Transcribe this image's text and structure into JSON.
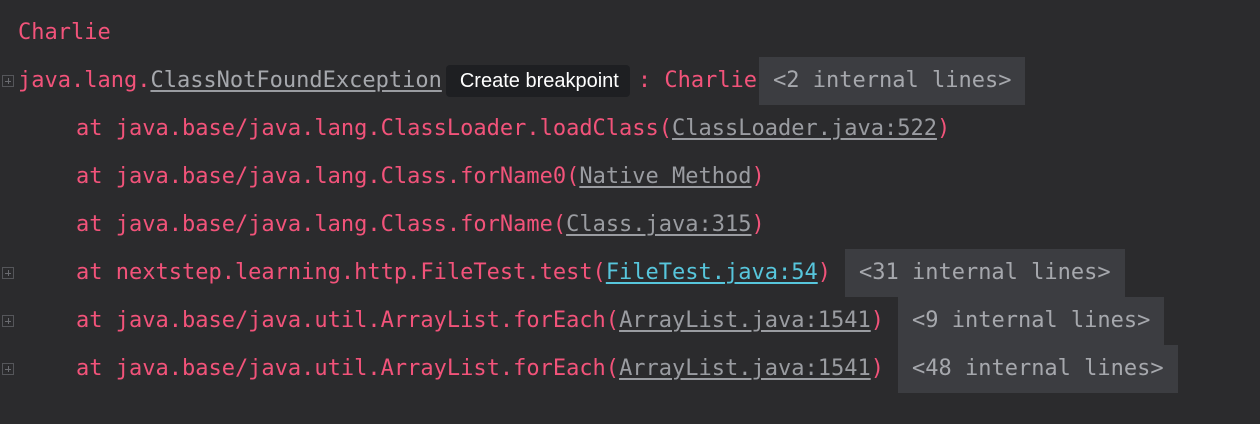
{
  "console": {
    "thread_name": "Charlie",
    "exception": {
      "prefix": "java.lang.",
      "class_name": "ClassNotFoundException",
      "tooltip": "Create breakpoint",
      "suffix": ": Charlie",
      "fold": "<2 internal lines>"
    },
    "frames": [
      {
        "text": "at java.base/java.lang.ClassLoader.loadClass(",
        "link": "ClassLoader.java:522",
        "close": ")",
        "fold": ""
      },
      {
        "text": "at java.base/java.lang.Class.forName0(",
        "link": "Native Method",
        "close": ")",
        "fold": ""
      },
      {
        "text": "at java.base/java.lang.Class.forName(",
        "link": "Class.java:315",
        "close": ")",
        "fold": ""
      },
      {
        "text": "at nextstep.learning.http.FileTest.test(",
        "link": "FileTest.java:54",
        "close": ")",
        "fold": "<31 internal lines>"
      },
      {
        "text": "at java.base/java.util.ArrayList.forEach(",
        "link": "ArrayList.java:1541",
        "close": ")",
        "fold": "<9 internal lines>"
      },
      {
        "text": "at java.base/java.util.ArrayList.forEach(",
        "link": "ArrayList.java:1541",
        "close": ")",
        "fold": "<48 internal lines>"
      }
    ]
  },
  "colors": {
    "background": "#2b2b2d",
    "error_text": "#f2537a",
    "link": "#9a9ca1",
    "active_link": "#57c6dc",
    "fold_background": "#3c3d41"
  }
}
